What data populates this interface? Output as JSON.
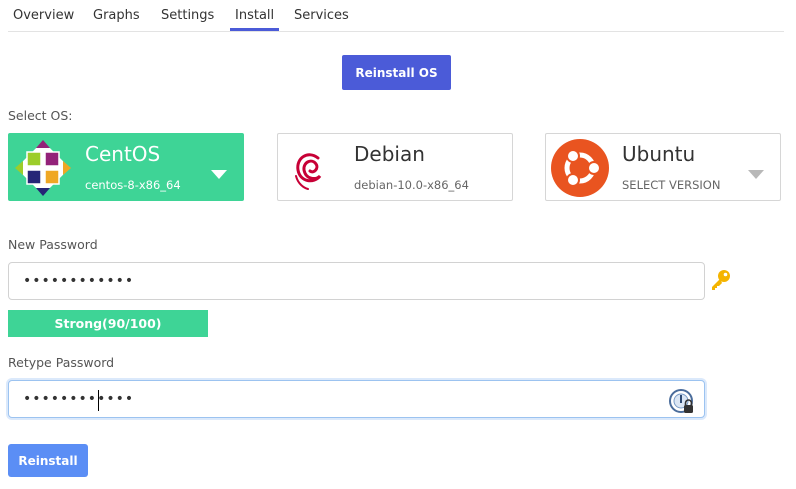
{
  "tabs": [
    {
      "label": "Overview"
    },
    {
      "label": "Graphs"
    },
    {
      "label": "Settings"
    },
    {
      "label": "Install",
      "active": true
    },
    {
      "label": "Services"
    }
  ],
  "reinstall_os_button": "Reinstall OS",
  "select_os_label": "Select OS:",
  "os_options": [
    {
      "name": "CentOS",
      "version": "centos-8-x86_64",
      "selected": true,
      "icon": "centos-logo-icon"
    },
    {
      "name": "Debian",
      "version": "debian-10.0-x86_64",
      "selected": false,
      "icon": "debian-logo-icon"
    },
    {
      "name": "Ubuntu",
      "version": "SELECT VERSION",
      "selected": false,
      "icon": "ubuntu-logo-icon"
    }
  ],
  "new_password": {
    "label": "New Password",
    "value": "••••••••••••"
  },
  "strength": {
    "text": "Strong(90/100)",
    "score": 90,
    "max": 100
  },
  "retype_password": {
    "label": "Retype Password",
    "value": "••••••••••••"
  },
  "reinstall_button": "Reinstall",
  "colors": {
    "accent": "#4b5bd8",
    "selected_card": "#3ed496",
    "reinstall_button": "#5b8ef5",
    "ubuntu": "#e95420",
    "debian": "#c70036"
  }
}
